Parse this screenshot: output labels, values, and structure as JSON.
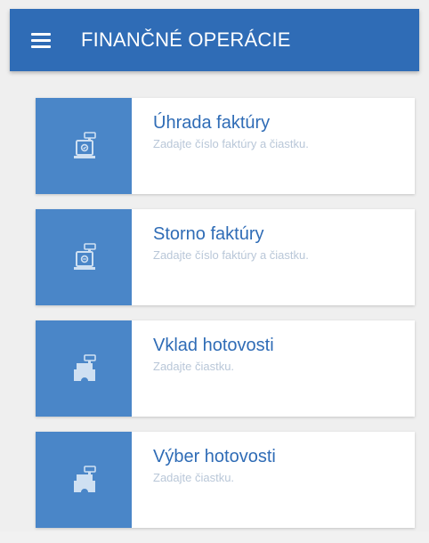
{
  "app_bar": {
    "title": "FINANČNÉ OPERÁCIE",
    "color": "#2f6cb6",
    "menu_icon": "hamburger-menu-icon"
  },
  "accent_colors": {
    "card_icon_bg": "#4a86c8",
    "title_text": "#2f6cb6",
    "subtitle_text": "#b9c7d8"
  },
  "operations": [
    {
      "title": "Úhrada faktúry",
      "subtitle": "Zadajte číslo faktúry a čiastku.",
      "icon": "cash-register-invoice-icon"
    },
    {
      "title": "Storno faktúry",
      "subtitle": "Zadajte číslo faktúry a čiastku.",
      "icon": "cash-register-invoice-icon"
    },
    {
      "title": "Vklad hotovosti",
      "subtitle": "Zadajte čiastku.",
      "icon": "cash-register-icon"
    },
    {
      "title": "Výber hotovosti",
      "subtitle": "Zadajte čiastku.",
      "icon": "cash-register-icon"
    }
  ]
}
